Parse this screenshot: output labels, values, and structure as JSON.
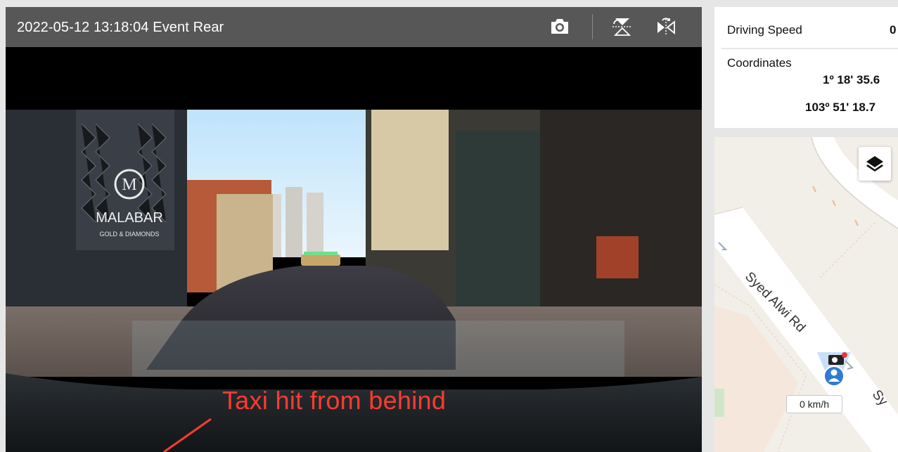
{
  "player": {
    "title": "2022-05-12 13:18:04 Event Rear",
    "controls": {
      "snapshot": "camera-icon",
      "flip_vertical": "flip-vertical-icon",
      "mirror": "mirror-flip-icon"
    }
  },
  "video": {
    "storefront_brand": "MALABAR",
    "storefront_tagline": "GOLD & DIAMONDS",
    "annotation": "Taxi hit from behind"
  },
  "info": {
    "speed_label": "Driving Speed",
    "speed_value": "0",
    "coords_label": "Coordinates",
    "latitude": "1º 18' 35.6",
    "longitude": "103º 51' 18.7"
  },
  "map": {
    "road_label_1": "Syed Alwi Rd",
    "road_label_2": "Sy",
    "speed_badge": "0 km/h",
    "layers_icon": "layers-icon",
    "marker_icon": "vehicle-marker-icon"
  },
  "colors": {
    "toolbar_bg": "#575757",
    "annotation": "#ff3b2f",
    "marker": "#2f7bd3"
  }
}
